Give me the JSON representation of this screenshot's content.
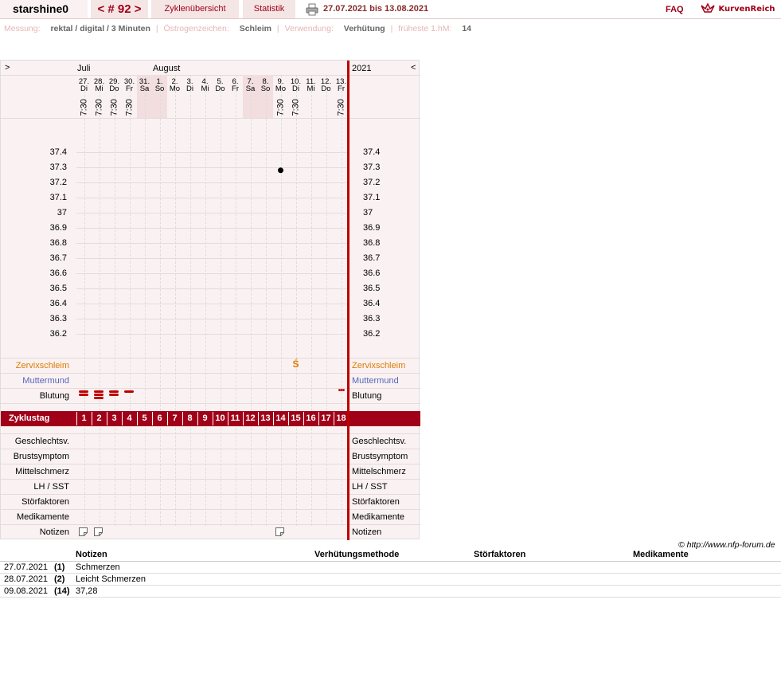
{
  "header": {
    "username": "starshine0",
    "cycle_nav": "< # 92 >",
    "tab_zyklen": "Zyklenübersicht",
    "tab_statistik": "Statistik",
    "date_range": "27.07.2021 bis 13.08.2021",
    "faq": "FAQ",
    "logo_text": "KurvenReich"
  },
  "info": {
    "messung_label": "Messung:",
    "messung_value": "rektal / digital / 3 Minuten",
    "oestrogen_label": "Östrogenzeichen:",
    "oestrogen_value": "Schleim",
    "verwendung_label": "Verwendung:",
    "verwendung_value": "Verhütung",
    "fhm_label": "früheste 1.hM:",
    "fhm_value": "14"
  },
  "chart": {
    "nav_left": ">",
    "nav_right": "<",
    "year": "2021",
    "month1": "Juli",
    "month2": "August",
    "days": [
      {
        "d": "27.",
        "w": "Di",
        "t": "7:30",
        "we": false
      },
      {
        "d": "28.",
        "w": "Mi",
        "t": "7:30",
        "we": false
      },
      {
        "d": "29.",
        "w": "Do",
        "t": "7:30",
        "we": false
      },
      {
        "d": "30.",
        "w": "Fr",
        "t": "7:30",
        "we": false
      },
      {
        "d": "31.",
        "w": "Sa",
        "t": "",
        "we": true
      },
      {
        "d": "1.",
        "w": "So",
        "t": "",
        "we": true
      },
      {
        "d": "2.",
        "w": "Mo",
        "t": "",
        "we": false
      },
      {
        "d": "3.",
        "w": "Di",
        "t": "",
        "we": false
      },
      {
        "d": "4.",
        "w": "Mi",
        "t": "",
        "we": false
      },
      {
        "d": "5.",
        "w": "Do",
        "t": "",
        "we": false
      },
      {
        "d": "6.",
        "w": "Fr",
        "t": "",
        "we": false
      },
      {
        "d": "7.",
        "w": "Sa",
        "t": "",
        "we": true
      },
      {
        "d": "8.",
        "w": "So",
        "t": "",
        "we": true
      },
      {
        "d": "9.",
        "w": "Mo",
        "t": "7:30",
        "we": false
      },
      {
        "d": "10.",
        "w": "Di",
        "t": "7:30",
        "we": false
      },
      {
        "d": "11.",
        "w": "Mi",
        "t": "",
        "we": false
      },
      {
        "d": "12.",
        "w": "Do",
        "t": "",
        "we": false
      },
      {
        "d": "13.",
        "w": "Fr",
        "t": "7:30",
        "we": false
      }
    ],
    "temps": [
      "37.4",
      "37.3",
      "37.2",
      "37.1",
      "37",
      "36.9",
      "36.8",
      "36.7",
      "36.6",
      "36.5",
      "36.4",
      "36.3",
      "36.2"
    ],
    "temperature_points": [
      {
        "day": 14,
        "value": 37.28
      }
    ],
    "zervix_label": "Zervixschleim",
    "zervix_mark": "Ś",
    "zervix_mark_day": 15,
    "muttermund_label": "Muttermund",
    "blutung_label": "Blutung",
    "bleeding": [
      {
        "day": 1,
        "level": 2
      },
      {
        "day": 2,
        "level": 3
      },
      {
        "day": 3,
        "level": 2
      },
      {
        "day": 4,
        "level": 1
      },
      {
        "day": 18,
        "level": 0
      }
    ],
    "zyklustag_label": "Zyklustag",
    "zyklustage": [
      "1",
      "2",
      "3",
      "4",
      "5",
      "6",
      "7",
      "8",
      "9",
      "10",
      "11",
      "12",
      "13",
      "14",
      "15",
      "16",
      "17",
      "18"
    ],
    "lower_rows": [
      "Geschlechtsv.",
      "Brustsymptom",
      "Mittelschmerz",
      "LH / SST",
      "Störfaktoren",
      "Medikamente",
      "Notizen"
    ],
    "note_days": [
      1,
      2,
      14
    ],
    "copyright": "© http://www.nfp-forum.de",
    "colors": {
      "accent": "#a00018",
      "zervix": "#e07a00",
      "muttermund": "#5566bb",
      "bg": "#faf2f2"
    }
  },
  "notes": {
    "headers": {
      "notizen": "Notizen",
      "methode": "Verhütungsmethode",
      "stoer": "Störfaktoren",
      "medik": "Medikamente"
    },
    "rows": [
      {
        "date": "27.07.2021",
        "day": "(1)",
        "text": "Schmerzen"
      },
      {
        "date": "28.07.2021",
        "day": "(2)",
        "text": "Leicht Schmerzen"
      },
      {
        "date": "09.08.2021",
        "day": "(14)",
        "text": "37,28"
      }
    ]
  }
}
